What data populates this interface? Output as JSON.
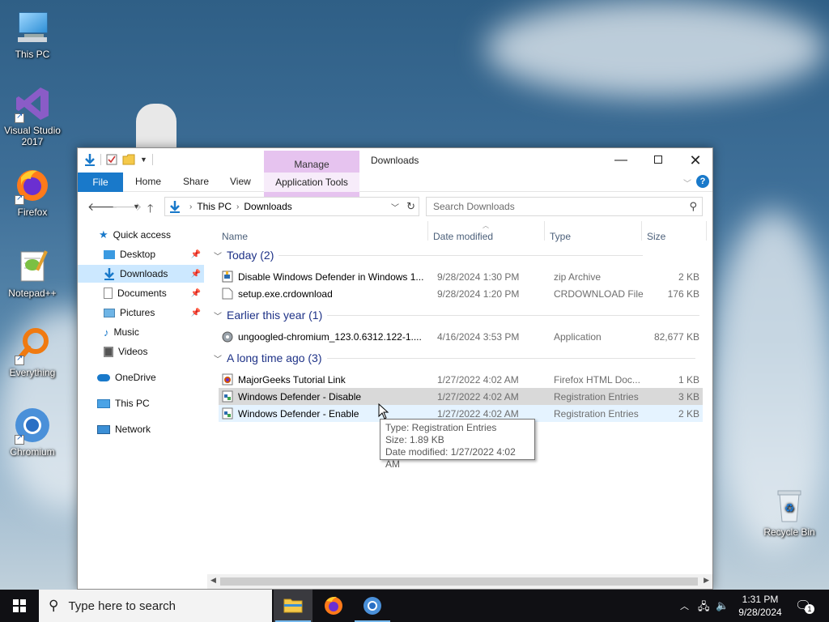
{
  "desktop": {
    "icons": [
      {
        "label": "This PC"
      },
      {
        "label": "Visual Studio 2017"
      },
      {
        "label": "Firefox"
      },
      {
        "label": "Notepad++"
      },
      {
        "label": "Everything"
      },
      {
        "label": "Chromium"
      },
      {
        "label": "Recycle Bin"
      }
    ]
  },
  "window": {
    "title": "Downloads",
    "contextual_group": "Manage",
    "ribbon_tabs": [
      "File",
      "Home",
      "Share",
      "View",
      "Application Tools"
    ],
    "address": {
      "segments": [
        "This PC",
        "Downloads"
      ]
    },
    "search_placeholder": "Search Downloads",
    "nav": [
      {
        "label": "Quick access"
      },
      {
        "label": "Desktop",
        "pinned": true
      },
      {
        "label": "Downloads",
        "pinned": true,
        "selected": true
      },
      {
        "label": "Documents",
        "pinned": true
      },
      {
        "label": "Pictures",
        "pinned": true
      },
      {
        "label": "Music"
      },
      {
        "label": "Videos"
      },
      {
        "label": "OneDrive"
      },
      {
        "label": "This PC"
      },
      {
        "label": "Network"
      }
    ],
    "columns": [
      "Name",
      "Date modified",
      "Type",
      "Size"
    ],
    "groups": [
      {
        "header": "Today (2)",
        "rows": [
          {
            "name": "Disable Windows Defender in Windows 1...",
            "date": "9/28/2024 1:30 PM",
            "type": "zip Archive",
            "size": "2 KB"
          },
          {
            "name": "setup.exe.crdownload",
            "date": "9/28/2024 1:20 PM",
            "type": "CRDOWNLOAD File",
            "size": "176 KB"
          }
        ]
      },
      {
        "header": "Earlier this year (1)",
        "rows": [
          {
            "name": "ungoogled-chromium_123.0.6312.122-1....",
            "date": "4/16/2024 3:53 PM",
            "type": "Application",
            "size": "82,677 KB"
          }
        ]
      },
      {
        "header": "A long time ago (3)",
        "rows": [
          {
            "name": "MajorGeeks Tutorial Link",
            "date": "1/27/2022 4:02 AM",
            "type": "Firefox HTML Doc...",
            "size": "1 KB"
          },
          {
            "name": "Windows Defender - Disable",
            "date": "1/27/2022 4:02 AM",
            "type": "Registration Entries",
            "size": "3 KB"
          },
          {
            "name": "Windows Defender - Enable",
            "date": "1/27/2022 4:02 AM",
            "type": "Registration Entries",
            "size": "2 KB"
          }
        ]
      }
    ],
    "tooltip": {
      "type": "Type: Registration Entries",
      "size": "Size: 1.89 KB",
      "date": "Date modified: 1/27/2022 4:02 AM"
    }
  },
  "taskbar": {
    "search_placeholder": "Type here to search",
    "time": "1:31 PM",
    "date": "9/28/2024",
    "notification_count": "1"
  },
  "colors": {
    "accent": "#1979ca",
    "manage_tab": "#e6c3ef",
    "selection": "#cce8ff",
    "group_header": "#1e3287"
  }
}
